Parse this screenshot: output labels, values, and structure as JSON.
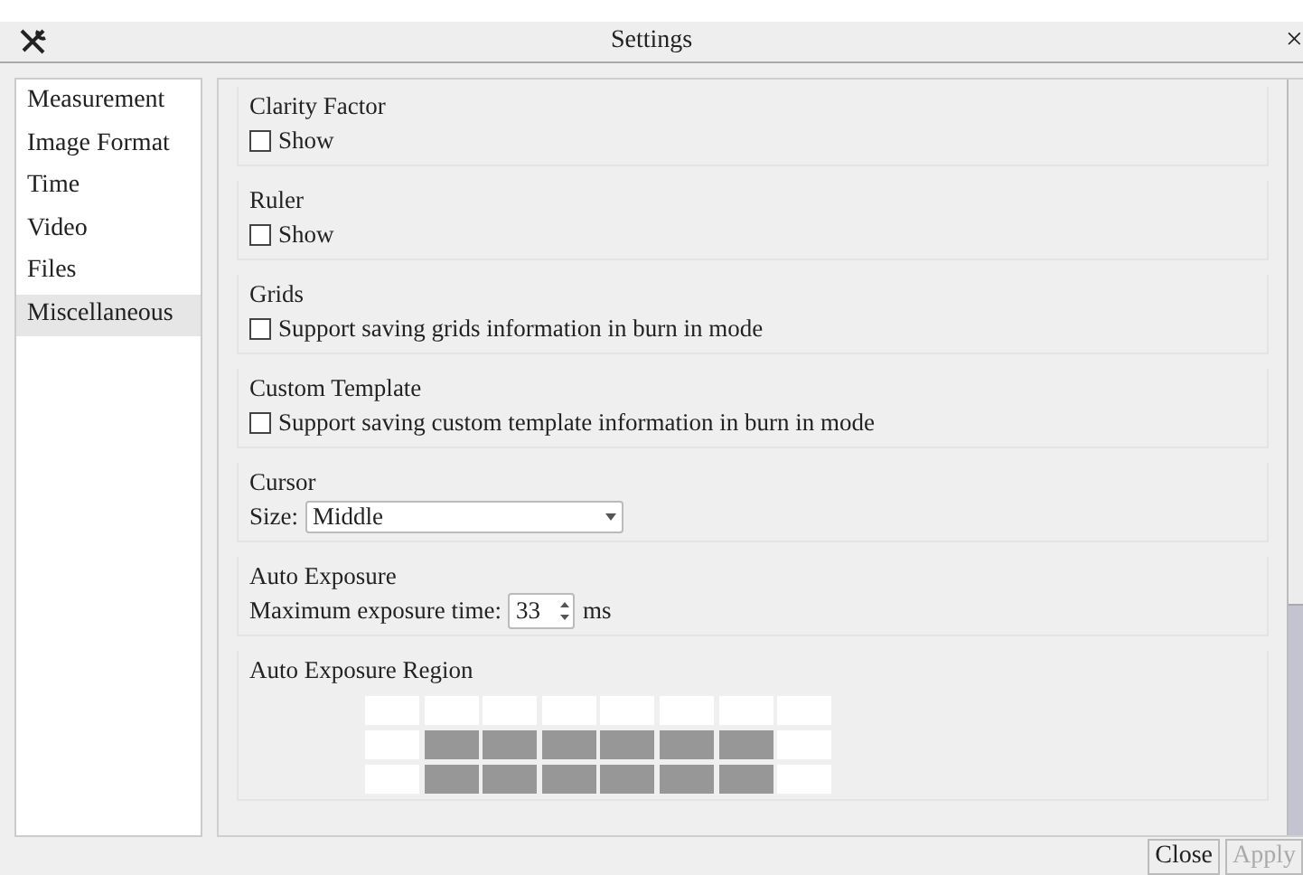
{
  "window": {
    "title": "Settings",
    "close": "×"
  },
  "sidebar": {
    "items": [
      {
        "label": "Measurement",
        "selected": false
      },
      {
        "label": "Image Format",
        "selected": false
      },
      {
        "label": "Time",
        "selected": false
      },
      {
        "label": "Video",
        "selected": false
      },
      {
        "label": "Files",
        "selected": false
      },
      {
        "label": "Miscellaneous",
        "selected": true
      }
    ]
  },
  "sections": [
    {
      "kind": "checkbox",
      "title": "Clarity Factor",
      "label": "Show",
      "checked": false
    },
    {
      "kind": "checkbox",
      "title": "Ruler",
      "label": "Show",
      "checked": false
    },
    {
      "kind": "checkbox",
      "title": "Grids",
      "label": "Support saving grids information in burn in mode",
      "checked": false
    },
    {
      "kind": "checkbox",
      "title": "Custom Template",
      "label": "Support saving custom template information in burn in mode",
      "checked": false
    },
    {
      "kind": "select",
      "title": "Cursor",
      "label": "Size:",
      "value": "Middle"
    },
    {
      "kind": "spinbox",
      "title": "Auto Exposure",
      "label": "Maximum exposure time:",
      "value": "33",
      "unit": "ms"
    },
    {
      "kind": "grid",
      "title": "Auto Exposure Region",
      "rows": [
        [
          {
            "selected": false
          },
          {
            "selected": false
          },
          {
            "selected": false
          },
          {
            "selected": false
          },
          {
            "selected": false
          },
          {
            "selected": false
          },
          {
            "selected": false
          },
          {
            "selected": false
          }
        ],
        [
          {
            "selected": false
          },
          {
            "selected": true
          },
          {
            "selected": true
          },
          {
            "selected": true
          },
          {
            "selected": true
          },
          {
            "selected": true
          },
          {
            "selected": true
          },
          {
            "selected": false
          }
        ],
        [
          {
            "selected": false
          },
          {
            "selected": true
          },
          {
            "selected": true
          },
          {
            "selected": true
          },
          {
            "selected": true
          },
          {
            "selected": true
          },
          {
            "selected": true
          },
          {
            "selected": false
          }
        ]
      ]
    }
  ],
  "buttons": [
    {
      "label": "Close",
      "disabled": false
    },
    {
      "label": "Apply",
      "disabled": true
    }
  ]
}
